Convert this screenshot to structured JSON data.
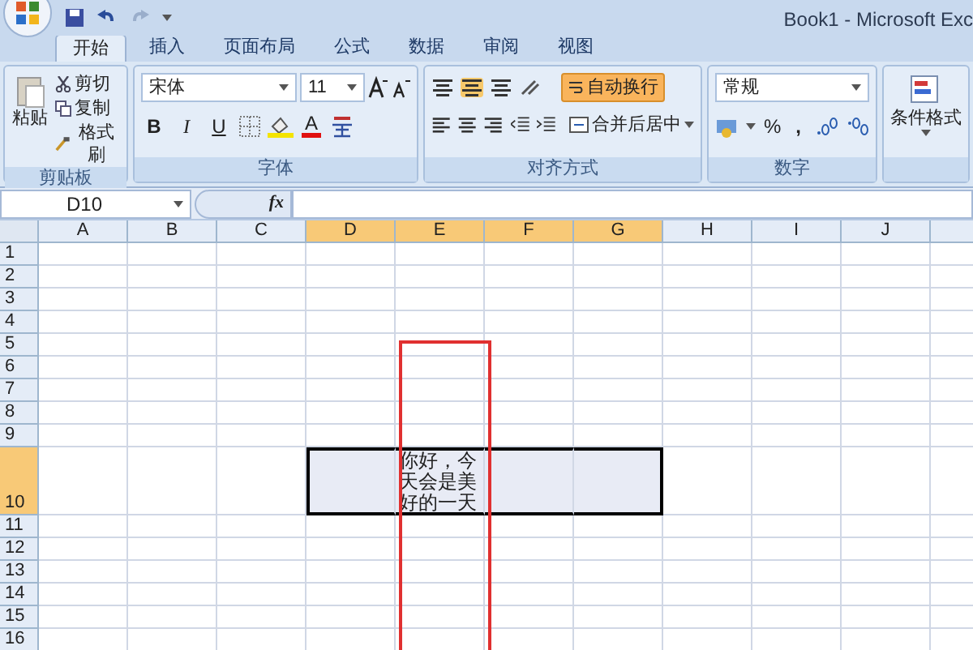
{
  "window": {
    "title": "Book1 - Microsoft Exc"
  },
  "tabs": [
    {
      "label": "开始",
      "selected": true
    },
    {
      "label": "插入",
      "selected": false
    },
    {
      "label": "页面布局",
      "selected": false
    },
    {
      "label": "公式",
      "selected": false
    },
    {
      "label": "数据",
      "selected": false
    },
    {
      "label": "审阅",
      "selected": false
    },
    {
      "label": "视图",
      "selected": false
    }
  ],
  "ribbon": {
    "clipboard": {
      "title": "剪贴板",
      "paste": "粘贴",
      "cut": "剪切",
      "copy": "复制",
      "format_painter": "格式刷"
    },
    "font": {
      "title": "字体",
      "font_name": "宋体",
      "font_size": "11",
      "bold": "B",
      "italic": "I",
      "underline": "U",
      "font_color": "A"
    },
    "alignment": {
      "title": "对齐方式",
      "wrap_text": {
        "label": "自动换行",
        "on": true
      },
      "merge_center": "合并后居中"
    },
    "number": {
      "title": "数字",
      "format": "常规",
      "percent": "%",
      "comma": ","
    },
    "styles": {
      "conditional_format": "条件格式"
    }
  },
  "formula_bar": {
    "name_box": "D10",
    "fx": "fx"
  },
  "sheet": {
    "columns": [
      {
        "label": "A",
        "selected": false
      },
      {
        "label": "B",
        "selected": false
      },
      {
        "label": "C",
        "selected": false
      },
      {
        "label": "D",
        "selected": true
      },
      {
        "label": "E",
        "selected": true,
        "holds_text": true
      },
      {
        "label": "F",
        "selected": true
      },
      {
        "label": "G",
        "selected": true
      },
      {
        "label": "H",
        "selected": false
      },
      {
        "label": "I",
        "selected": false
      },
      {
        "label": "J",
        "selected": false
      }
    ],
    "rows": [
      {
        "label": "1",
        "selected": false
      },
      {
        "label": "2",
        "selected": false
      },
      {
        "label": "3",
        "selected": false
      },
      {
        "label": "4",
        "selected": false
      },
      {
        "label": "5",
        "selected": false
      },
      {
        "label": "6",
        "selected": false
      },
      {
        "label": "7",
        "selected": false
      },
      {
        "label": "8",
        "selected": false
      },
      {
        "label": "9",
        "selected": false
      },
      {
        "label": "10",
        "selected": true,
        "text": "你好，今天会是美好的一天"
      },
      {
        "label": "11",
        "selected": false
      },
      {
        "label": "12",
        "selected": false
      },
      {
        "label": "13",
        "selected": false
      },
      {
        "label": "14",
        "selected": false
      },
      {
        "label": "15",
        "selected": false
      },
      {
        "label": "16",
        "selected": false
      }
    ]
  }
}
